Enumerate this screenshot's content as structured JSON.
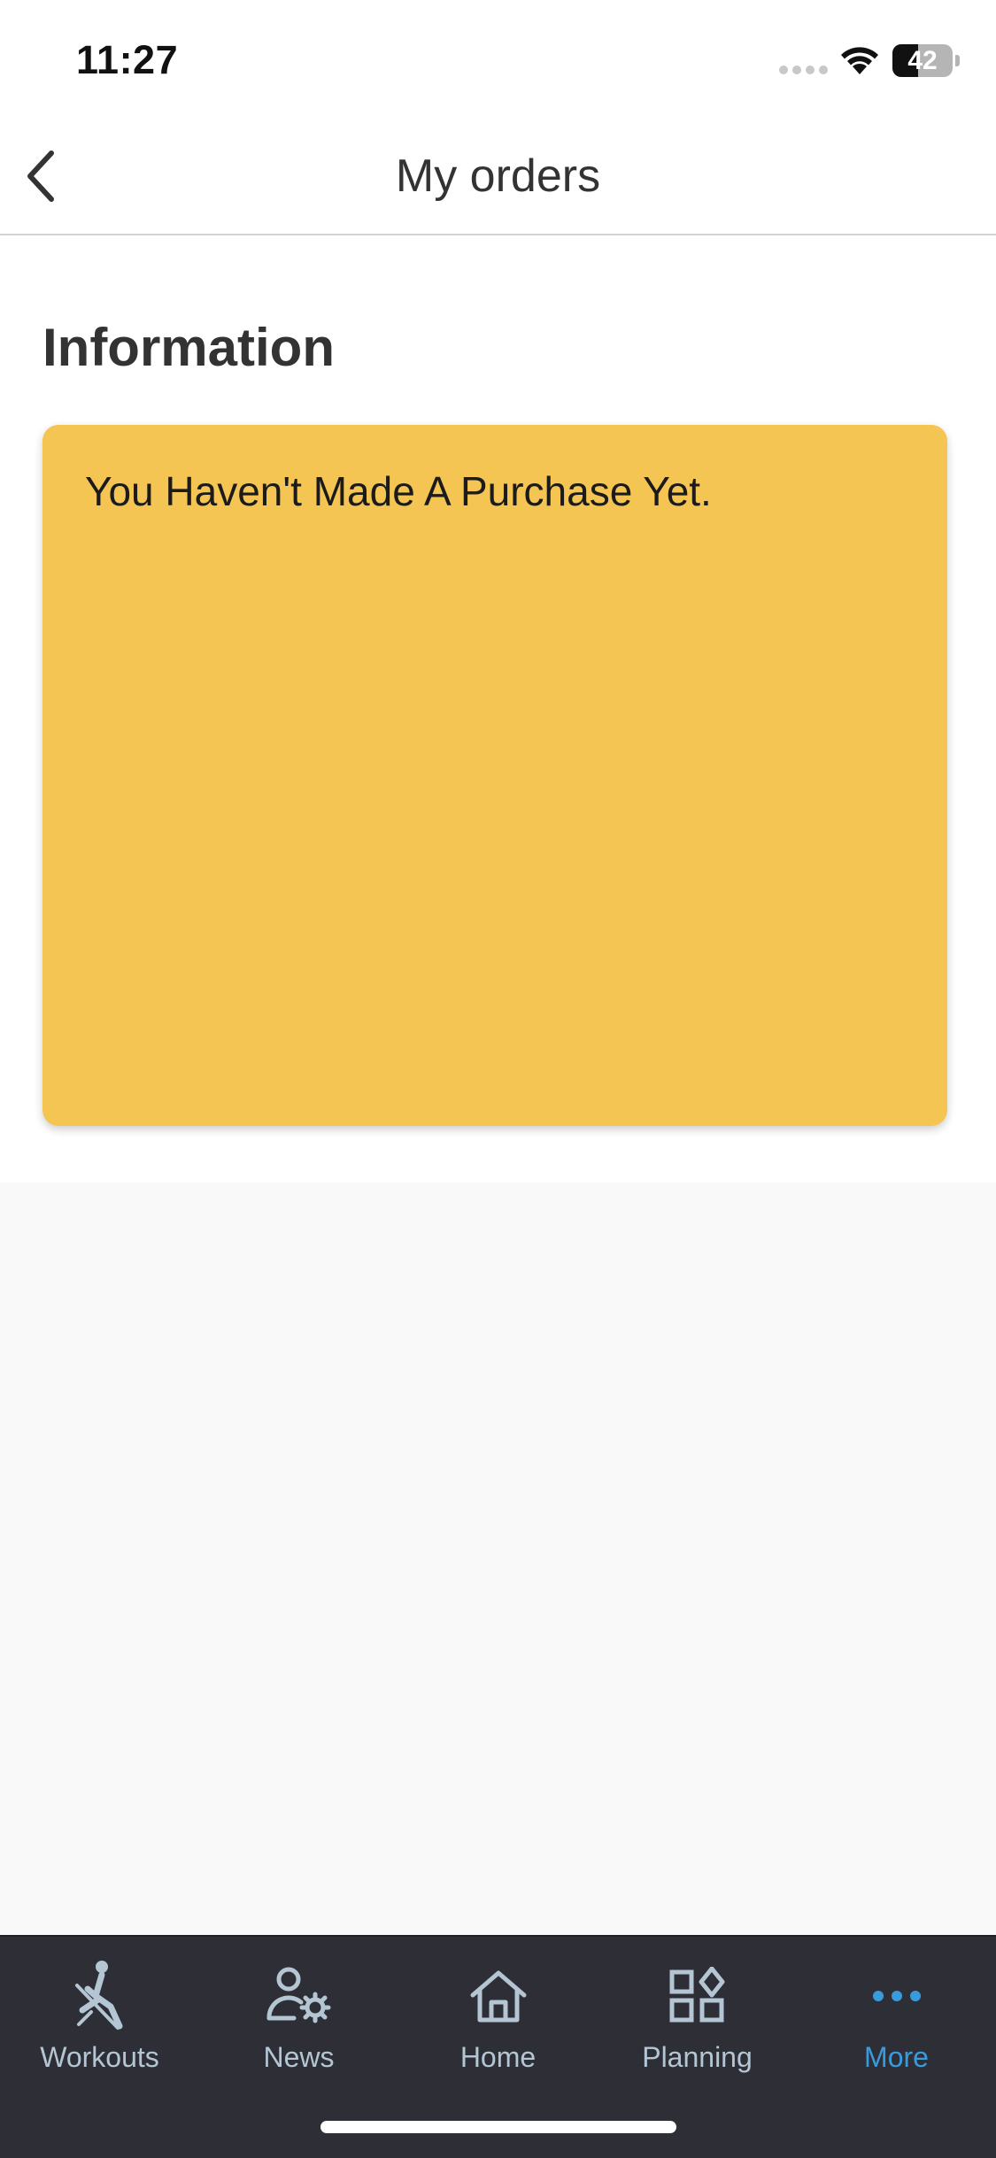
{
  "status_bar": {
    "time": "11:27",
    "battery": "42",
    "battery_level": 0.42
  },
  "header": {
    "title": "My orders",
    "back_icon": "chevron-left-icon"
  },
  "section": {
    "title": "Information"
  },
  "info_card": {
    "message": "You Haven't Made A Purchase Yet.",
    "color": "#f4c553"
  },
  "tab_bar": {
    "background": "#2e2f36",
    "active_color": "#3a9bdc",
    "inactive_color": "#b4c6d4",
    "active_tab": "More",
    "tabs": [
      {
        "label": "Workouts",
        "icon": "workout-figure-icon"
      },
      {
        "label": "News",
        "icon": "user-gear-icon"
      },
      {
        "label": "Home",
        "icon": "home-icon"
      },
      {
        "label": "Planning",
        "icon": "grid-shapes-icon"
      },
      {
        "label": "More",
        "icon": "more-dots-icon"
      }
    ]
  }
}
